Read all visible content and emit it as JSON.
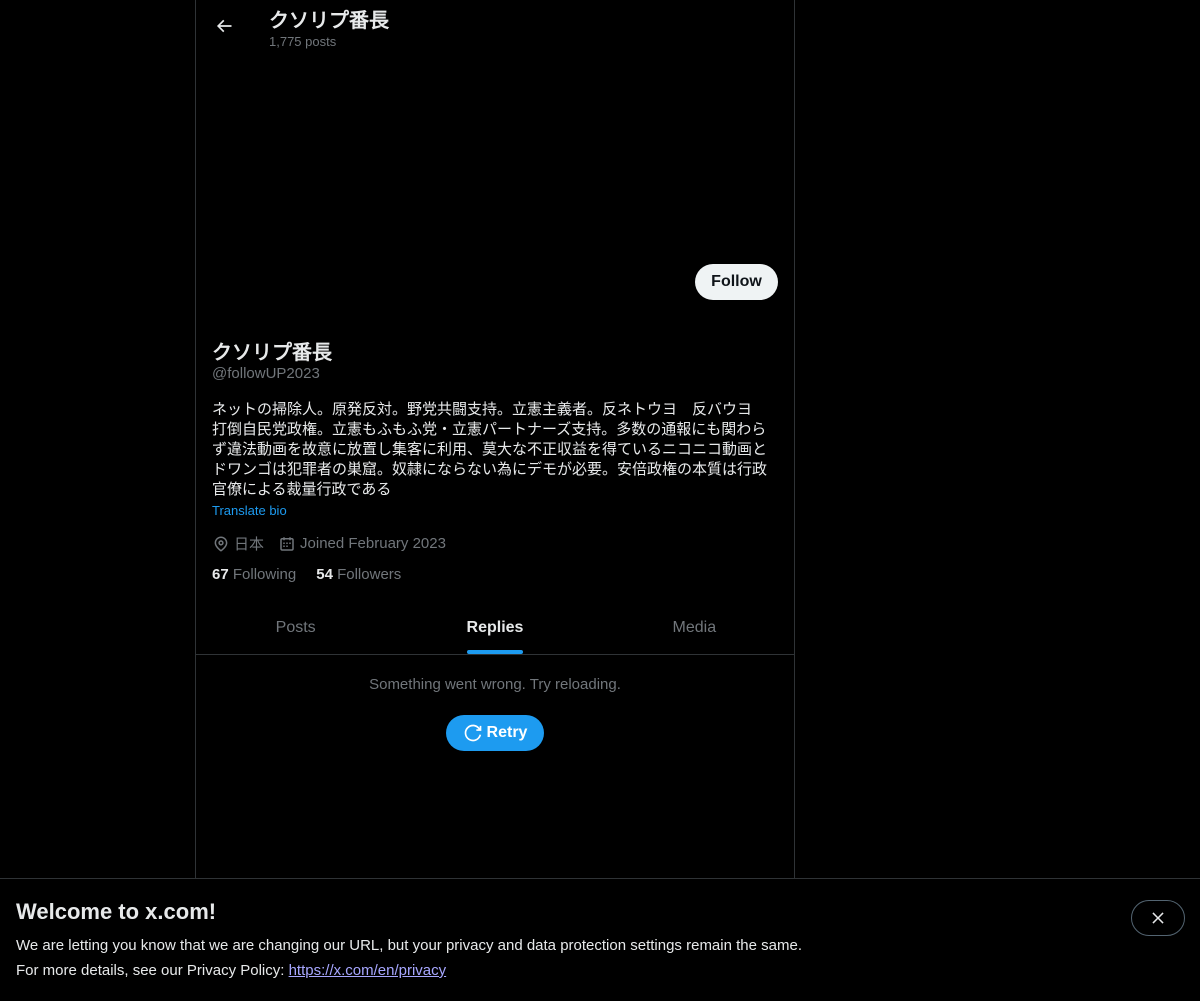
{
  "header": {
    "title": "クソリプ番長",
    "post_count": "1,775 posts"
  },
  "profile": {
    "follow_label": "Follow",
    "display_name": "クソリプ番長",
    "handle": "@followUP2023",
    "bio_lines": [
      "ネットの掃除人。原発反対。野党共闘支持。立憲主義者。反ネトウヨ　反バウヨ",
      "打倒自民党政権。立憲もふもふ党・立憲パートナーズ支持。多数の通報にも関わら",
      "ず違法動画を故意に放置し集客に利用、莫大な不正収益を得ているニコニコ動画と",
      "ドワンゴは犯罪者の巣窟。奴隷にならない為にデモが必要。安倍政権の本質は行政",
      "官僚による裁量行政である"
    ],
    "translate_label": "Translate bio",
    "location": "日本",
    "joined": "Joined February 2023",
    "following_count": "67",
    "following_label": "Following",
    "followers_count": "54",
    "followers_label": "Followers"
  },
  "tabs": [
    {
      "label": "Posts",
      "active": false
    },
    {
      "label": "Replies",
      "active": true
    },
    {
      "label": "Media",
      "active": false
    }
  ],
  "feed": {
    "error_message": "Something went wrong. Try reloading.",
    "retry_label": "Retry"
  },
  "notice": {
    "title": "Welcome to x.com!",
    "line1": "We are letting you know that we are changing our URL, but your privacy and data protection settings remain the same.",
    "line2_prefix": "For more details, see our Privacy Policy: ",
    "link_text": "https://x.com/en/privacy"
  },
  "colors": {
    "accent": "#1d9bf0",
    "background": "#000000",
    "text": "#e7e9ea",
    "muted": "#71767b"
  },
  "icons": {
    "back": "arrow-left-icon",
    "location": "location-pin-icon",
    "calendar": "calendar-icon",
    "retry": "refresh-icon",
    "close": "close-icon"
  }
}
